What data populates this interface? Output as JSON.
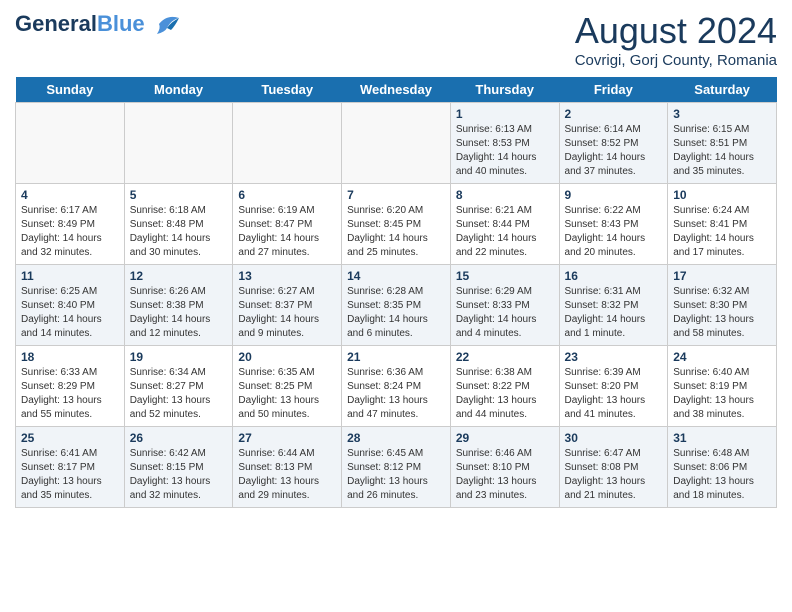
{
  "header": {
    "logo_general": "General",
    "logo_blue": "Blue",
    "month_year": "August 2024",
    "location": "Covrigi, Gorj County, Romania"
  },
  "days_of_week": [
    "Sunday",
    "Monday",
    "Tuesday",
    "Wednesday",
    "Thursday",
    "Friday",
    "Saturday"
  ],
  "weeks": [
    [
      {
        "day": "",
        "content": ""
      },
      {
        "day": "",
        "content": ""
      },
      {
        "day": "",
        "content": ""
      },
      {
        "day": "",
        "content": ""
      },
      {
        "day": "1",
        "content": "Sunrise: 6:13 AM\nSunset: 8:53 PM\nDaylight: 14 hours\nand 40 minutes."
      },
      {
        "day": "2",
        "content": "Sunrise: 6:14 AM\nSunset: 8:52 PM\nDaylight: 14 hours\nand 37 minutes."
      },
      {
        "day": "3",
        "content": "Sunrise: 6:15 AM\nSunset: 8:51 PM\nDaylight: 14 hours\nand 35 minutes."
      }
    ],
    [
      {
        "day": "4",
        "content": "Sunrise: 6:17 AM\nSunset: 8:49 PM\nDaylight: 14 hours\nand 32 minutes."
      },
      {
        "day": "5",
        "content": "Sunrise: 6:18 AM\nSunset: 8:48 PM\nDaylight: 14 hours\nand 30 minutes."
      },
      {
        "day": "6",
        "content": "Sunrise: 6:19 AM\nSunset: 8:47 PM\nDaylight: 14 hours\nand 27 minutes."
      },
      {
        "day": "7",
        "content": "Sunrise: 6:20 AM\nSunset: 8:45 PM\nDaylight: 14 hours\nand 25 minutes."
      },
      {
        "day": "8",
        "content": "Sunrise: 6:21 AM\nSunset: 8:44 PM\nDaylight: 14 hours\nand 22 minutes."
      },
      {
        "day": "9",
        "content": "Sunrise: 6:22 AM\nSunset: 8:43 PM\nDaylight: 14 hours\nand 20 minutes."
      },
      {
        "day": "10",
        "content": "Sunrise: 6:24 AM\nSunset: 8:41 PM\nDaylight: 14 hours\nand 17 minutes."
      }
    ],
    [
      {
        "day": "11",
        "content": "Sunrise: 6:25 AM\nSunset: 8:40 PM\nDaylight: 14 hours\nand 14 minutes."
      },
      {
        "day": "12",
        "content": "Sunrise: 6:26 AM\nSunset: 8:38 PM\nDaylight: 14 hours\nand 12 minutes."
      },
      {
        "day": "13",
        "content": "Sunrise: 6:27 AM\nSunset: 8:37 PM\nDaylight: 14 hours\nand 9 minutes."
      },
      {
        "day": "14",
        "content": "Sunrise: 6:28 AM\nSunset: 8:35 PM\nDaylight: 14 hours\nand 6 minutes."
      },
      {
        "day": "15",
        "content": "Sunrise: 6:29 AM\nSunset: 8:33 PM\nDaylight: 14 hours\nand 4 minutes."
      },
      {
        "day": "16",
        "content": "Sunrise: 6:31 AM\nSunset: 8:32 PM\nDaylight: 14 hours\nand 1 minute."
      },
      {
        "day": "17",
        "content": "Sunrise: 6:32 AM\nSunset: 8:30 PM\nDaylight: 13 hours\nand 58 minutes."
      }
    ],
    [
      {
        "day": "18",
        "content": "Sunrise: 6:33 AM\nSunset: 8:29 PM\nDaylight: 13 hours\nand 55 minutes."
      },
      {
        "day": "19",
        "content": "Sunrise: 6:34 AM\nSunset: 8:27 PM\nDaylight: 13 hours\nand 52 minutes."
      },
      {
        "day": "20",
        "content": "Sunrise: 6:35 AM\nSunset: 8:25 PM\nDaylight: 13 hours\nand 50 minutes."
      },
      {
        "day": "21",
        "content": "Sunrise: 6:36 AM\nSunset: 8:24 PM\nDaylight: 13 hours\nand 47 minutes."
      },
      {
        "day": "22",
        "content": "Sunrise: 6:38 AM\nSunset: 8:22 PM\nDaylight: 13 hours\nand 44 minutes."
      },
      {
        "day": "23",
        "content": "Sunrise: 6:39 AM\nSunset: 8:20 PM\nDaylight: 13 hours\nand 41 minutes."
      },
      {
        "day": "24",
        "content": "Sunrise: 6:40 AM\nSunset: 8:19 PM\nDaylight: 13 hours\nand 38 minutes."
      }
    ],
    [
      {
        "day": "25",
        "content": "Sunrise: 6:41 AM\nSunset: 8:17 PM\nDaylight: 13 hours\nand 35 minutes."
      },
      {
        "day": "26",
        "content": "Sunrise: 6:42 AM\nSunset: 8:15 PM\nDaylight: 13 hours\nand 32 minutes."
      },
      {
        "day": "27",
        "content": "Sunrise: 6:44 AM\nSunset: 8:13 PM\nDaylight: 13 hours\nand 29 minutes."
      },
      {
        "day": "28",
        "content": "Sunrise: 6:45 AM\nSunset: 8:12 PM\nDaylight: 13 hours\nand 26 minutes."
      },
      {
        "day": "29",
        "content": "Sunrise: 6:46 AM\nSunset: 8:10 PM\nDaylight: 13 hours\nand 23 minutes."
      },
      {
        "day": "30",
        "content": "Sunrise: 6:47 AM\nSunset: 8:08 PM\nDaylight: 13 hours\nand 21 minutes."
      },
      {
        "day": "31",
        "content": "Sunrise: 6:48 AM\nSunset: 8:06 PM\nDaylight: 13 hours\nand 18 minutes."
      }
    ]
  ]
}
